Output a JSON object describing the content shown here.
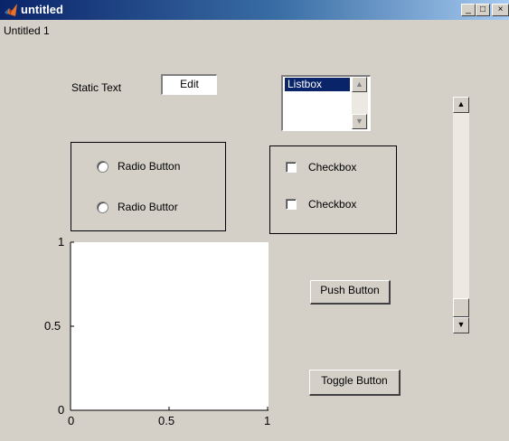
{
  "window": {
    "title": "untitled",
    "menu_label": "Untitled 1",
    "controls": {
      "minimize": "_",
      "maximize": "□",
      "close": "×"
    }
  },
  "controls": {
    "static_text": "Static Text",
    "edit_value": "Edit",
    "listbox": {
      "items": [
        "Listbox"
      ],
      "selected_index": 0
    },
    "radio_group": [
      {
        "label": "Radio Button",
        "selected": false
      },
      {
        "label": "Radio Buttor",
        "selected": false
      }
    ],
    "checkbox_group": [
      {
        "label": "Checkbox",
        "checked": false
      },
      {
        "label": "Checkbox",
        "checked": false
      }
    ],
    "push_button": "Push Button",
    "toggle_button": "Toggle Button",
    "slider": {
      "value": 0.16
    }
  },
  "axes": {
    "x_ticks": [
      "0",
      "0.5",
      "1"
    ],
    "y_ticks": [
      "1",
      "0.5",
      "0"
    ]
  },
  "icons": {
    "app_icon": "matlab-icon",
    "scroll_up": "arrow-up-icon",
    "scroll_down": "arrow-down-icon"
  },
  "colors": {
    "title_bar_start": "#0a246a",
    "title_bar_end": "#a6caf0",
    "face": "#d4d0c8",
    "selection": "#0a246a"
  }
}
